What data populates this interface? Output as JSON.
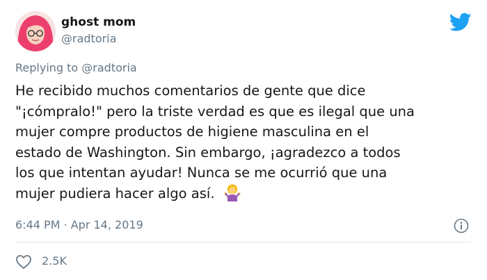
{
  "tweet": {
    "author": {
      "display_name": "ghost mom",
      "handle": "@radtoria"
    },
    "reply_context": {
      "prefix": "Replying to",
      "mention": "@radtoria"
    },
    "text_lines": [
      "He recibido muchos comentarios de gente que dice",
      "\"¡cómpralo!\" pero la triste verdad es que es ilegal que una",
      "mujer compre productos de higiene masculina en el",
      "estado de Washington. Sin embargo, ¡agradezco a todos",
      "los que intentan ayudar! Nunca se me ocurrió que una",
      "mujer pudiera hacer algo así."
    ],
    "emoji": "person-shrugging-emoji",
    "timestamp": "6:44 PM · Apr 14, 2019",
    "likes": "2.5K"
  },
  "icons": {
    "brand": "twitter-bird-icon",
    "info": "info-icon",
    "like": "heart-icon"
  },
  "colors": {
    "twitter_blue": "#1da1f2",
    "text": "#14171a",
    "secondary_text": "#657786",
    "divider": "#e1e8ed"
  }
}
